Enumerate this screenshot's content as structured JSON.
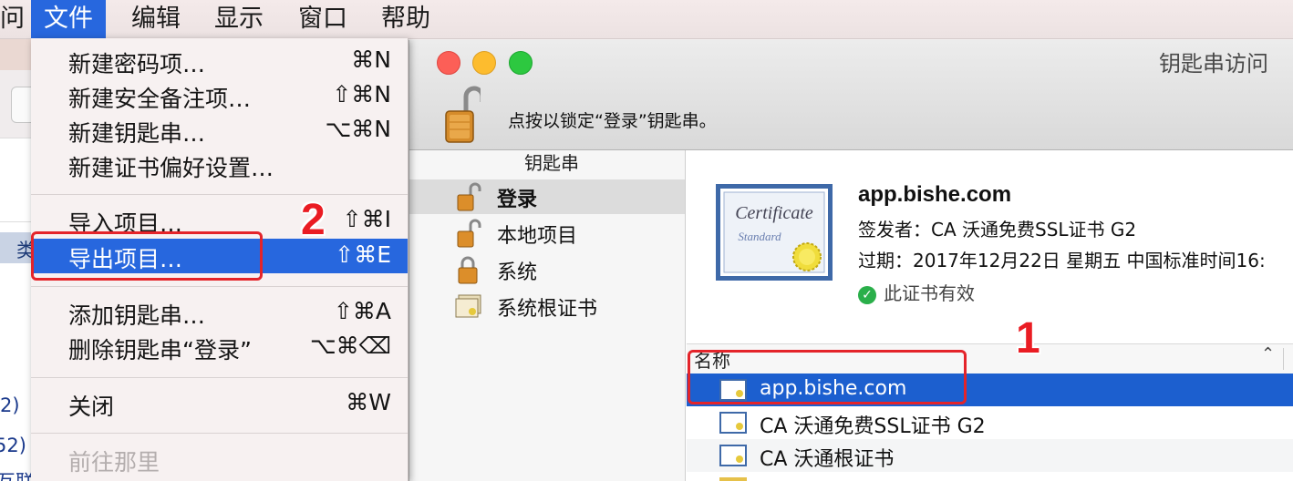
{
  "menubar": {
    "items": [
      {
        "label": "问"
      },
      {
        "label": "文件"
      },
      {
        "label": "编辑"
      },
      {
        "label": "显示"
      },
      {
        "label": "窗口"
      },
      {
        "label": "帮助"
      }
    ]
  },
  "background_app": {
    "tag_text": "类",
    "snippets": [
      "2)",
      "52)",
      "互联"
    ]
  },
  "file_menu": {
    "items": [
      {
        "label": "新建密码项…",
        "shortcut": "⌘N"
      },
      {
        "label": "新建安全备注项…",
        "shortcut": "⇧⌘N"
      },
      {
        "label": "新建钥匙串…",
        "shortcut": "⌥⌘N"
      },
      {
        "label": "新建证书偏好设置…",
        "shortcut": ""
      },
      {
        "label": "导入项目…",
        "shortcut": "⇧⌘I"
      },
      {
        "label": "导出项目…",
        "shortcut": "⇧⌘E"
      },
      {
        "label": "添加钥匙串…",
        "shortcut": "⇧⌘A"
      },
      {
        "label": "删除钥匙串“登录”",
        "shortcut": "⌥⌘⌫"
      },
      {
        "label": "关闭",
        "shortcut": "⌘W"
      },
      {
        "label": "前往那里",
        "shortcut": ""
      }
    ],
    "highlighted_index": 5,
    "disabled_index": 9
  },
  "window": {
    "title": "钥匙串访问",
    "lock_message": "点按以锁定“登录”钥匙串。",
    "sidebar": {
      "header": "钥匙串",
      "items": [
        {
          "label": "登录",
          "icon": "unlocked-padlock-icon",
          "selected": true
        },
        {
          "label": "本地项目",
          "icon": "unlocked-padlock-icon",
          "selected": false
        },
        {
          "label": "系统",
          "icon": "locked-padlock-icon",
          "selected": false
        },
        {
          "label": "系统根证书",
          "icon": "certificate-stack-icon",
          "selected": false
        }
      ]
    },
    "detail": {
      "name": "app.bishe.com",
      "issuer": "签发者：CA 沃通免费SSL证书 G2",
      "expires": "过期：2017年12月22日 星期五 中国标准时间16:",
      "status": "此证书有效",
      "cert_title": "Certificate",
      "cert_sub": "Standard"
    },
    "list": {
      "column": "名称",
      "rows": [
        {
          "label": "app.bishe.com",
          "selected": true
        },
        {
          "label": "CA 沃通免费SSL证书 G2",
          "selected": false
        },
        {
          "label": "CA 沃通根证书",
          "selected": false
        }
      ]
    }
  },
  "annotations": {
    "step1": "1",
    "step2": "2"
  },
  "colors": {
    "menu_highlight": "#2767de",
    "row_selected": "#1c5fcf",
    "annotation_red": "#e4242a",
    "valid_green": "#2aaf4a"
  }
}
